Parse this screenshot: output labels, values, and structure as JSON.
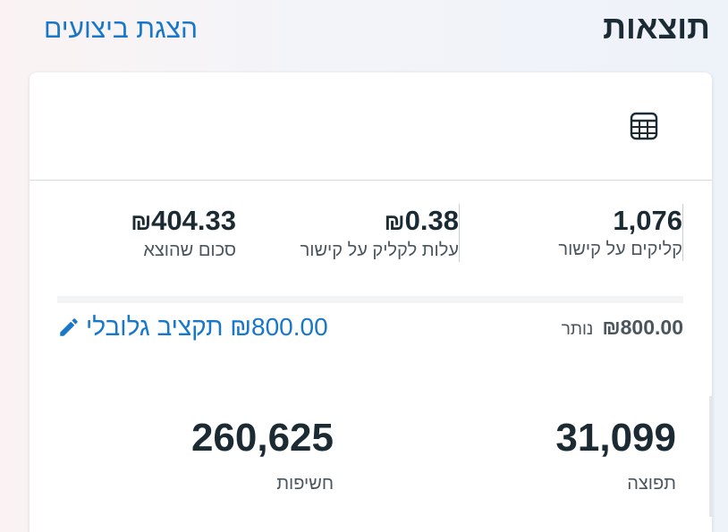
{
  "header": {
    "title": "תוצאות",
    "performance_link": "הצגת ביצועים"
  },
  "card": {
    "table_icon": "table-icon",
    "metrics": [
      {
        "value": "1,076",
        "currency": "",
        "label": "קליקים על קישור"
      },
      {
        "value": "0.38",
        "currency": "₪",
        "label": "עלות לקליק על קישור"
      },
      {
        "value": "404.33",
        "currency": "₪",
        "label": "סכום שהוצא"
      }
    ],
    "budget": {
      "remaining_amount": "₪800.00",
      "remaining_label": "נותר",
      "global_budget_text": "₪800.00 תקציב גלובלי",
      "edit_icon": "pencil-icon"
    },
    "reach": {
      "value": "31,099",
      "label": "תפוצה"
    },
    "impressions": {
      "value": "260,625",
      "label": "חשיפות"
    }
  }
}
